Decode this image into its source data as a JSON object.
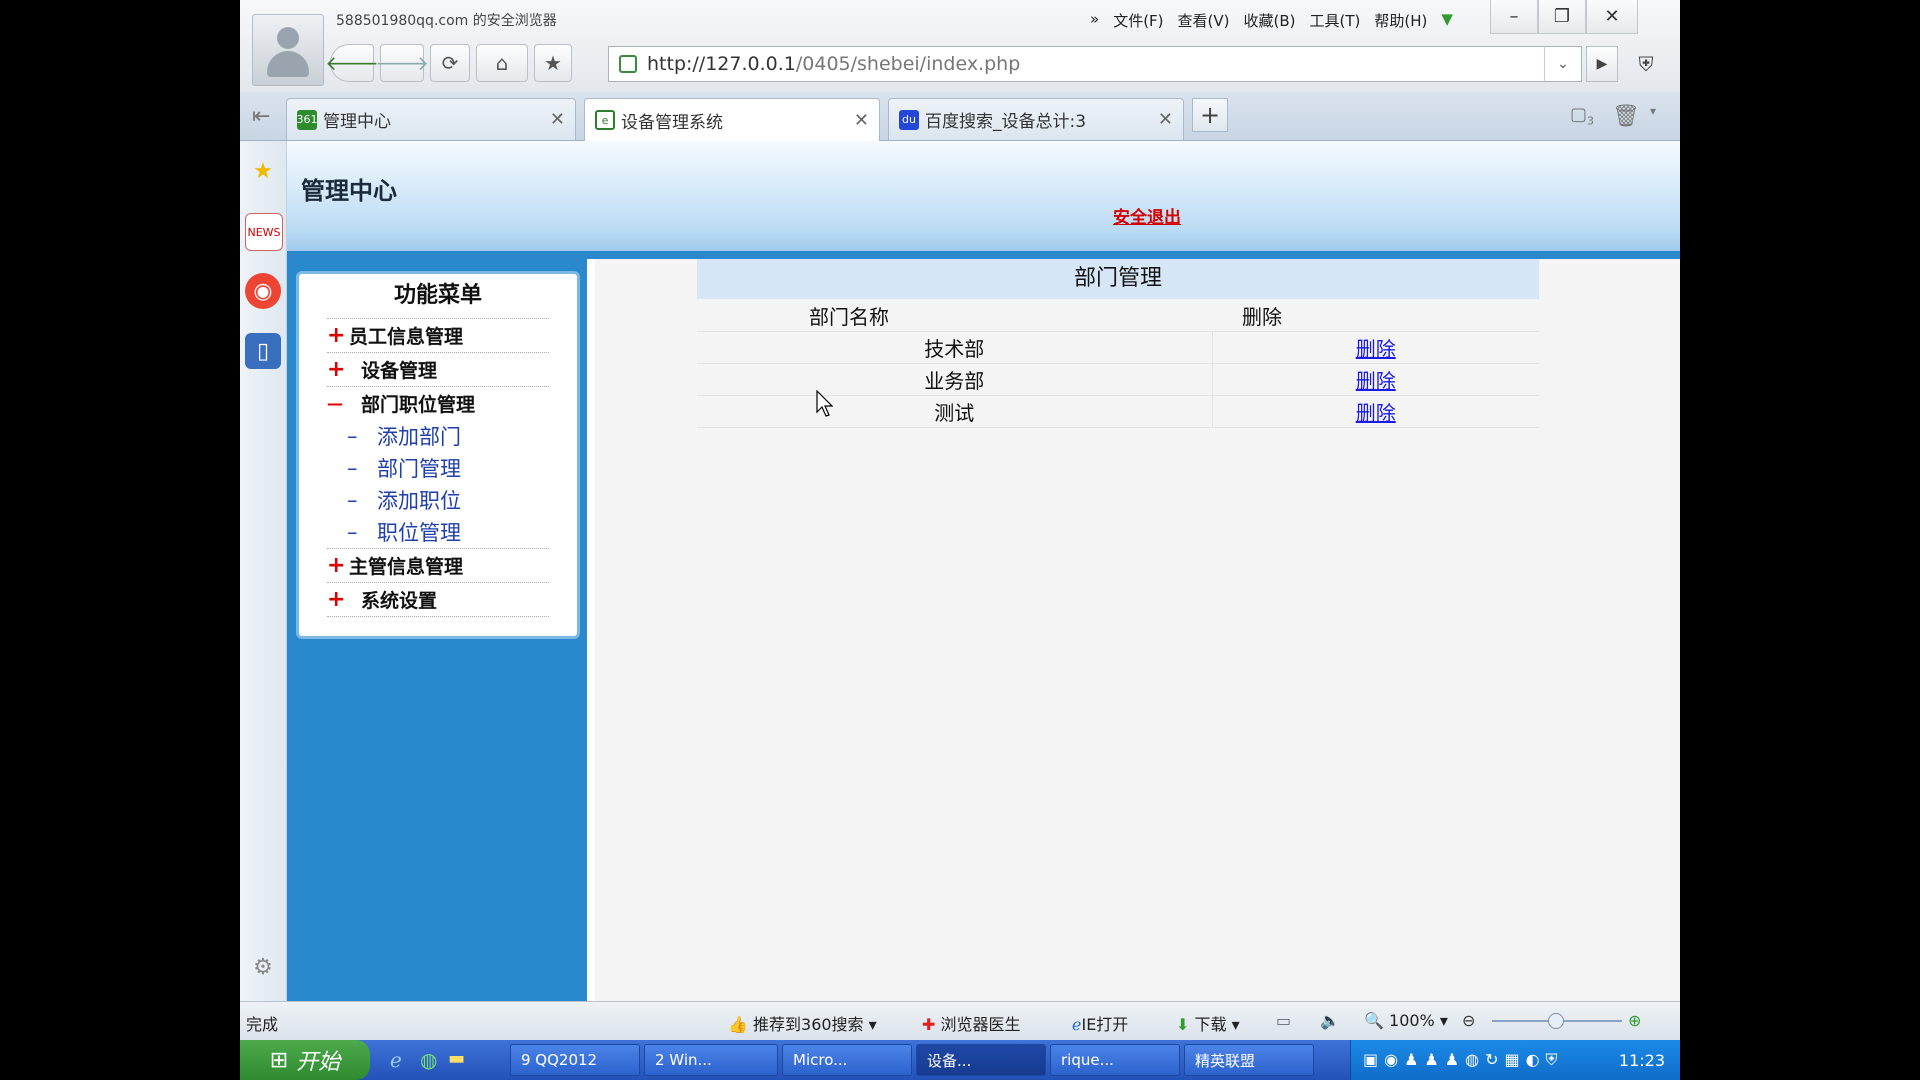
{
  "browser": {
    "account": "588501980qq.com 的安全浏览器",
    "menu": [
      "文件(F)",
      "查看(V)",
      "收藏(B)",
      "工具(T)",
      "帮助(H)"
    ],
    "menu_more": "»",
    "window_controls": {
      "minimize": "–",
      "restore": "❐",
      "close": "✕"
    },
    "url_host": "http://127.0.0.1",
    "url_path": "/0405/shebei/index.php",
    "tabs": [
      {
        "label": "管理中心",
        "icon": "360-icon",
        "icon_text": "361"
      },
      {
        "label": "设备管理系统",
        "icon": "ie-page-icon",
        "icon_text": "e"
      },
      {
        "label": "百度搜索_设备总计:3",
        "icon": "baidu-icon",
        "icon_text": "du"
      }
    ],
    "tab_close": "✕",
    "new_tab": "+",
    "closed_tabs_count": "3"
  },
  "page": {
    "title": "管理中心",
    "logout": "安全退出",
    "menu_title": "功能菜单",
    "menu_groups": [
      {
        "sign": "+",
        "label": "员工信息管理"
      },
      {
        "sign": "+",
        "label": "设备管理"
      },
      {
        "sign": "—",
        "label": "部门职位管理",
        "items": [
          "添加部门",
          "部门管理",
          "添加职位",
          "职位管理"
        ]
      },
      {
        "sign": "+",
        "label": "主管信息管理"
      },
      {
        "sign": "+",
        "label": "系统设置"
      }
    ],
    "sub_dash": "–",
    "table": {
      "caption": "部门管理",
      "headers": [
        "部门名称",
        "删除"
      ],
      "rows": [
        {
          "name": "技术部",
          "action": "删除"
        },
        {
          "name": "业务部",
          "action": "删除"
        },
        {
          "name": "测试",
          "action": "删除"
        }
      ]
    }
  },
  "status": {
    "done": "完成",
    "recommend": "推荐到360搜索",
    "doctor": "浏览器医生",
    "ie_open": "IE打开",
    "download": "下载",
    "zoom": "100%"
  },
  "taskbar": {
    "start": "开始",
    "buttons": [
      "9 QQ2012",
      "2 Win...",
      "Micro...",
      "设备...",
      "rique...",
      "精英联盟"
    ],
    "time": "11:23"
  }
}
